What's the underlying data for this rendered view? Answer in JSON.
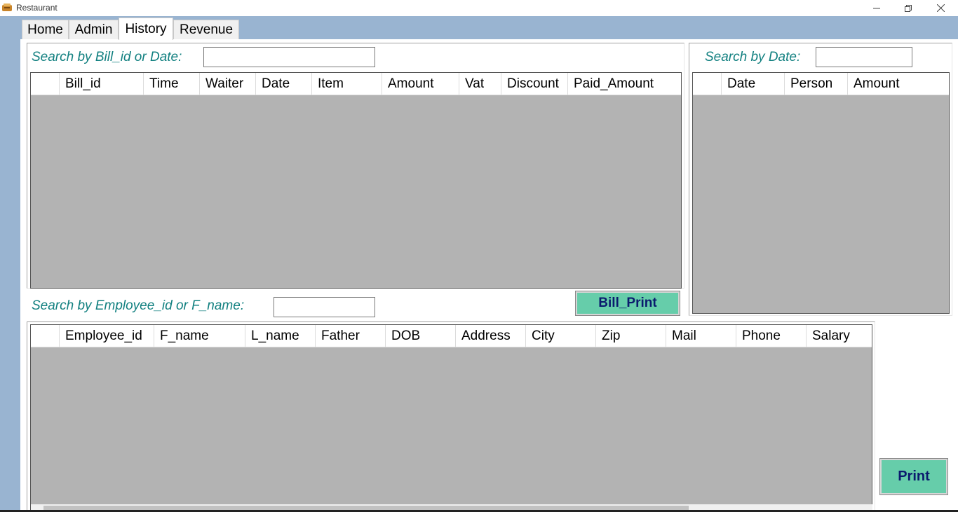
{
  "window": {
    "title": "Restaurant"
  },
  "tabs": [
    {
      "label": "Home"
    },
    {
      "label": "Admin"
    },
    {
      "label": "History"
    },
    {
      "label": "Revenue"
    }
  ],
  "bills": {
    "search_label": "Search by Bill_id or Date:",
    "search_value": "",
    "columns": [
      "Bill_id",
      "Time",
      "Waiter",
      "Date",
      "Item",
      "Amount",
      "Vat",
      "Discount",
      "Paid_Amount"
    ],
    "print_button": "Bill_Print"
  },
  "date_search": {
    "search_label": "Search by Date:",
    "search_value": "",
    "columns": [
      "Date",
      "Person",
      "Amount"
    ]
  },
  "employees": {
    "search_label": "Search by Employee_id or F_name:",
    "search_value": "",
    "columns": [
      "Employee_id",
      "F_name",
      "L_name",
      "Father",
      "DOB",
      "Address",
      "City",
      "Zip",
      "Mail",
      "Phone",
      "Salary"
    ],
    "print_button": "Print"
  },
  "colors": {
    "frame": "#99b4d1",
    "label": "#128080",
    "button": "#66cdaa",
    "grid_background": "#b3b3b3"
  }
}
